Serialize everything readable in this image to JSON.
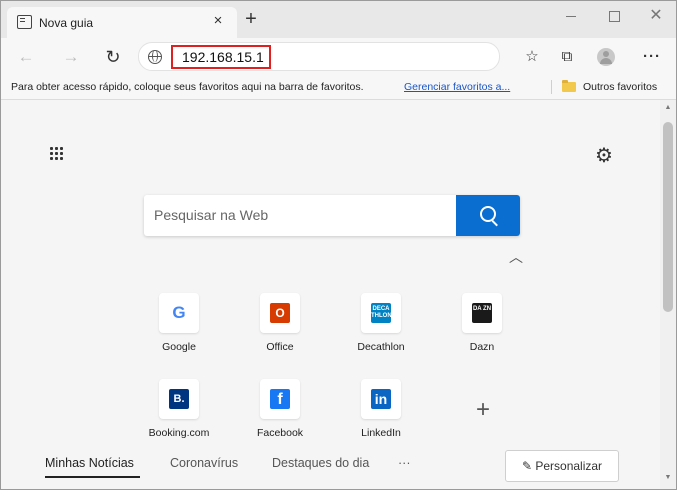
{
  "tab": {
    "title": "Nova guia",
    "close_glyph": "×",
    "new_tab_glyph": "+"
  },
  "window_controls": {
    "close_glyph": "✕"
  },
  "toolbar": {
    "back_glyph": "←",
    "forward_glyph": "→",
    "reload_glyph": "↻",
    "url": "192.168.15.1",
    "url_highlight_color": "#e02020",
    "fav_add_glyph": "☆",
    "collections_glyph": "⧉",
    "more_glyph": "···"
  },
  "favorites_bar": {
    "hint_text": "Para obter acesso rápido, coloque seus favoritos aqui na barra de favoritos.",
    "manage_link": "Gerenciar favoritos a...",
    "other_favorites": "Outros favoritos"
  },
  "page": {
    "search_placeholder": "Pesquisar na Web",
    "search_button_color": "#0a6ed1",
    "gear_glyph": "⚙",
    "collapse_glyph": "︿",
    "tiles": [
      {
        "label": "Google",
        "icon": "google-logo",
        "glyph": "G"
      },
      {
        "label": "Office",
        "icon": "office-logo",
        "glyph": "O"
      },
      {
        "label": "Decathlon",
        "icon": "decathlon-logo",
        "glyph": "DECA THLON"
      },
      {
        "label": "Dazn",
        "icon": "dazn-logo",
        "glyph": "DA ZN"
      },
      {
        "label": "Booking.com",
        "icon": "booking-logo",
        "glyph": "B."
      },
      {
        "label": "Facebook",
        "icon": "facebook-logo",
        "glyph": "f"
      },
      {
        "label": "LinkedIn",
        "icon": "linkedin-logo",
        "glyph": "in"
      }
    ],
    "add_tile_glyph": "+",
    "news_tabs": [
      "Minhas Notícias",
      "Coronavírus",
      "Destaques do dia",
      "···"
    ],
    "personalize_label": "✎ Personalizar"
  },
  "scrollbar": {
    "up_glyph": "▲",
    "down_glyph": "▼"
  }
}
